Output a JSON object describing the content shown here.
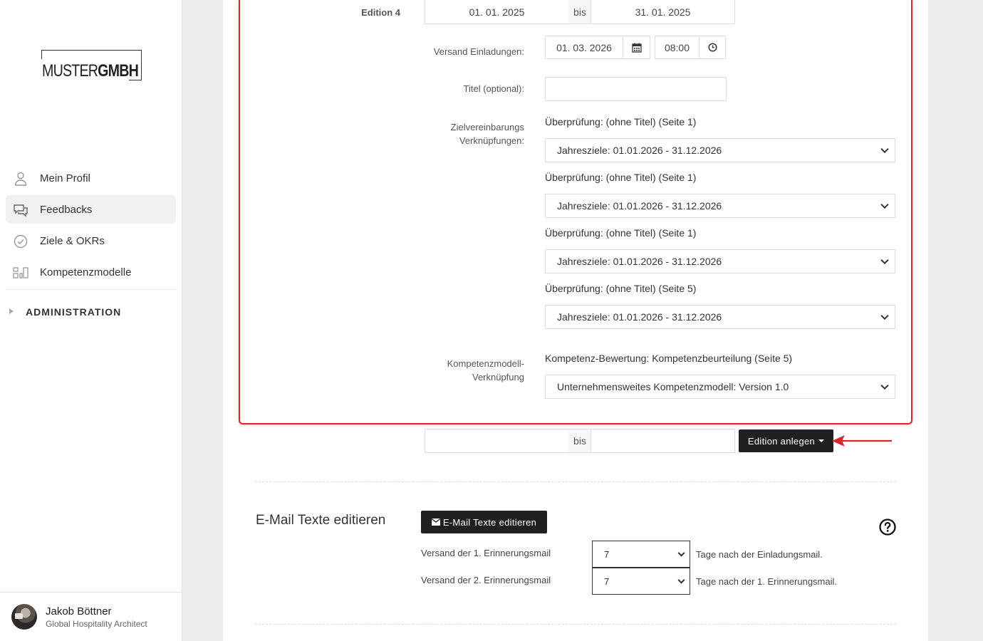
{
  "sidebar": {
    "logo": {
      "text_light": "MUSTER",
      "text_bold": "GMBH"
    },
    "items": [
      {
        "label": "Mein Profil",
        "icon": "user-icon",
        "active": false
      },
      {
        "label": "Feedbacks",
        "icon": "chat-icon",
        "active": true
      },
      {
        "label": "Ziele & OKRs",
        "icon": "check-circle-icon",
        "active": false
      },
      {
        "label": "Kompetenzmodelle",
        "icon": "grid-icon",
        "active": false
      }
    ],
    "admin_label": "ADMINISTRATION",
    "user": {
      "name": "Jakob Böttner",
      "role": "Global Hospitality Architect"
    }
  },
  "edition": {
    "label": "Edition 4",
    "date_from": "01. 01. 2025",
    "bis": "bis",
    "date_to": "31. 01. 2025",
    "invite_label": "Versand Einladungen:",
    "invite_date": "01. 03. 2026",
    "invite_time": "08:00",
    "title_label": "Titel (optional):",
    "title_value": "",
    "goal_links_label_1": "Zielvereinbarungs",
    "goal_links_label_2": "Verknüpfungen:",
    "goal_links": [
      {
        "heading": "Überprüfung: (ohne Titel) (Seite 1)",
        "selected": "Jahresziele: 01.01.2026 - 31.12.2026"
      },
      {
        "heading": "Überprüfung: (ohne Titel) (Seite 1)",
        "selected": "Jahresziele: 01.01.2026 - 31.12.2026"
      },
      {
        "heading": "Überprüfung: (ohne Titel) (Seite 1)",
        "selected": "Jahresziele: 01.01.2026 - 31.12.2026"
      },
      {
        "heading": "Überprüfung: (ohne Titel) (Seite 5)",
        "selected": "Jahresziele: 01.01.2026 - 31.12.2026"
      }
    ],
    "competence_label_1": "Kompetenzmodell-",
    "competence_label_2": "Verknüpfung",
    "competence_heading": "Kompetenz-Bewertung: Kompetenzbeurteilung (Seite 5)",
    "competence_selected": "Unternehmensweites Kompetenzmodell: Version 1.0"
  },
  "new_edition": {
    "date_from": "",
    "bis": "bis",
    "date_to": "",
    "button_label": "Edition anlegen"
  },
  "email": {
    "section_title": "E-Mail Texte editieren",
    "button_label": "E-Mail Texte editieren",
    "reminder1_label": "Versand der 1. Erinnerungsmail",
    "reminder1_value": "7",
    "reminder1_suffix": "Tage nach der Einladungsmail.",
    "reminder2_label": "Versand der 2. Erinnerungsmail",
    "reminder2_value": "7",
    "reminder2_suffix": "Tage nach der 1. Erinnerungsmail."
  },
  "colors": {
    "highlight": "#d7282f",
    "button_dark": "#202020",
    "background": "#ececec"
  }
}
